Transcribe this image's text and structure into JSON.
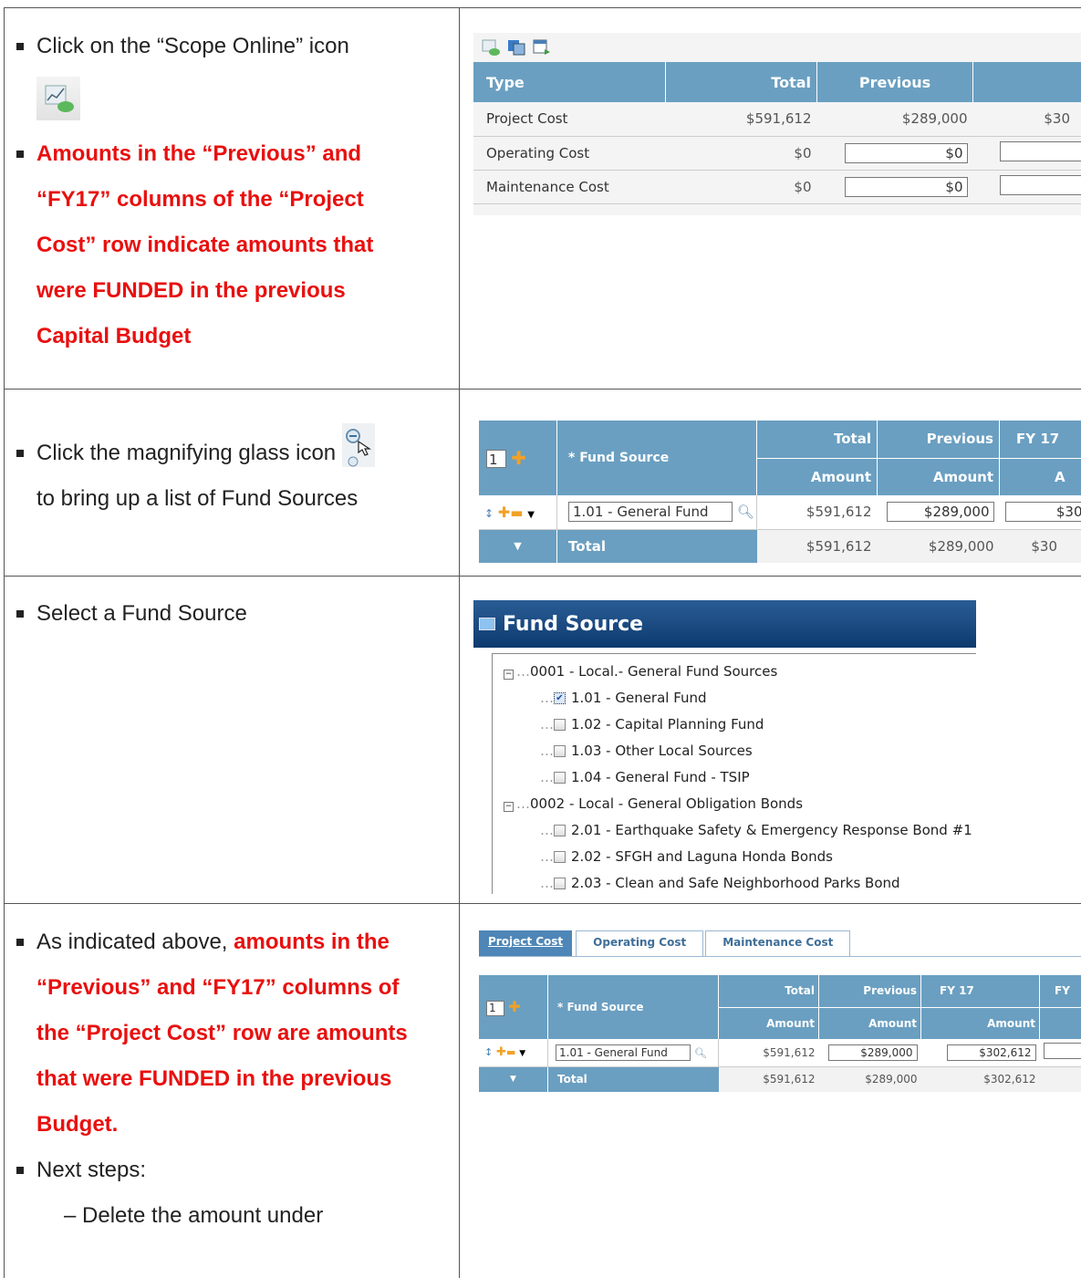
{
  "rows": [
    {
      "instruction": "Click on the “Scope Online” icon",
      "note_lines": [
        "Amounts in the “Previous” and",
        "“FY17” columns of the “Project",
        "Cost” row indicate amounts that",
        "were FUNDED in the previous",
        "Capital Budget"
      ]
    },
    {
      "instruction_a": "Click the magnifying glass icon",
      "instruction_b": "to bring up a list of Fund Sources"
    },
    {
      "instruction": "Select a Fund Source"
    },
    {
      "lead": "As indicated above,",
      "note_lines": [
        "amounts in the",
        "“Previous” and “FY17” columns of",
        "the “Project Cost” row are amounts",
        "that were FUNDED in the previous",
        "Budget."
      ],
      "next_steps": "Next steps:",
      "sub_step": "– Delete the amount under"
    }
  ],
  "scope_table": {
    "headers": [
      "Type",
      "Total",
      "Previous"
    ],
    "rows": [
      {
        "type": "Project Cost",
        "total": "$591,612",
        "previous": "$289,000",
        "next": "$30"
      },
      {
        "type": "Operating Cost",
        "total": "$0",
        "previous": "$0"
      },
      {
        "type": "Maintenance Cost",
        "total": "$0",
        "previous": "$0"
      }
    ]
  },
  "fund_table": {
    "count": "1",
    "fund_source_label": "* Fund Source",
    "total_label": "Total",
    "previous_label": "Previous",
    "fy17_label": "FY 17",
    "amount_label": "Amount",
    "amount_partial": "A",
    "row_fund": "1.01 - General Fund",
    "row_total": "$591,612",
    "row_previous": "$289,000",
    "row_next": "$30",
    "total_row_label": "Total",
    "total_total": "$591,612",
    "total_previous": "$289,000",
    "total_next": "$30"
  },
  "fund_dialog": {
    "title": "Fund Source",
    "groups": [
      {
        "label": "0001 - Local.- General Fund Sources",
        "items": [
          "1.01 - General Fund",
          "1.02 - Capital Planning Fund",
          "1.03 - Other Local Sources",
          "1.04 - General Fund - TSIP"
        ]
      },
      {
        "label": "0002 - Local - General Obligation Bonds",
        "items": [
          "2.01 - Earthquake Safety & Emergency Response Bond #1",
          "2.02 - SFGH and Laguna Honda Bonds",
          "2.03 - Clean and Safe Neighborhood Parks Bond"
        ]
      }
    ]
  },
  "tabs": [
    "Project Cost",
    "Operating Cost",
    "Maintenance Cost"
  ],
  "final_table": {
    "count": "1",
    "fund_source_label": "* Fund Source",
    "total_label": "Total",
    "previous_label": "Previous",
    "fy17_label": "FY 17",
    "fy_partial": "FY",
    "amount_label": "Amount",
    "row_fund": "1.01 - General Fund",
    "row_total": "$591,612",
    "row_previous": "$289,000",
    "row_fy17": "$302,612",
    "total_row_label": "Total",
    "total_total": "$591,612",
    "total_previous": "$289,000",
    "total_fy17": "$302,612"
  }
}
